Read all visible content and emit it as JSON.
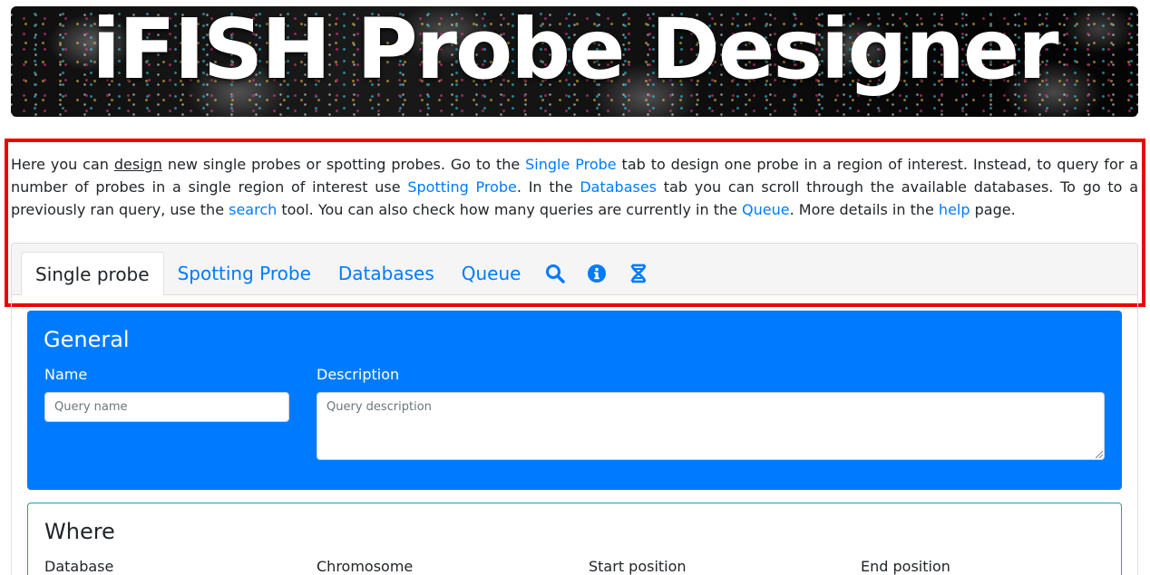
{
  "banner": {
    "title": "iFISH Probe Designer"
  },
  "intro": {
    "p1": "Here you can ",
    "design": "design",
    "p2": " new single probes or spotting probes. Go to the ",
    "single_probe_link": "Single Probe",
    "p3": " tab to design one probe in a region of interest. Instead, to query for a number of probes in a single region of interest use ",
    "spotting_probe_link": "Spotting Probe",
    "p4": ". In the ",
    "databases_link": "Databases",
    "p5": " tab you can scroll through the available databases. To go to a previously ran query, use the ",
    "search_link": "search",
    "p6": " tool. You can also check how many queries are currently in the ",
    "queue_link": "Queue",
    "p7": ". More details in the ",
    "help_link": "help",
    "p8": " page."
  },
  "tabs": [
    {
      "label": "Single probe",
      "active": true
    },
    {
      "label": "Spotting Probe"
    },
    {
      "label": "Databases"
    },
    {
      "label": "Queue"
    }
  ],
  "tab_icons": [
    "search-icon",
    "info-icon",
    "dna-icon"
  ],
  "general": {
    "title": "General",
    "name_label": "Name",
    "name_placeholder": "Query name",
    "description_label": "Description",
    "description_placeholder": "Query description"
  },
  "where": {
    "title": "Where",
    "labels": [
      "Database",
      "Chromosome",
      "Start position",
      "End position"
    ]
  },
  "colors": {
    "accent": "#007bff",
    "highlight": "#ee0000",
    "where_border": "#17a2b8"
  }
}
